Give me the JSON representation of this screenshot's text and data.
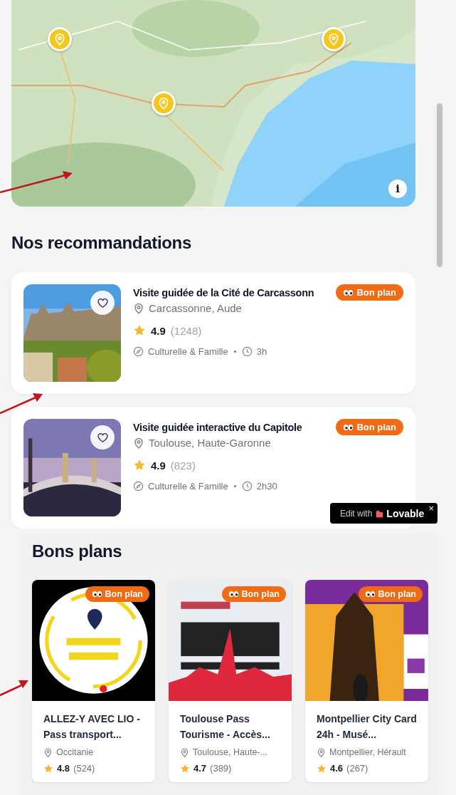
{
  "map": {
    "markers": [
      {
        "kind": "pin"
      },
      {
        "kind": "pin"
      },
      {
        "kind": "pin"
      }
    ],
    "info_button": {
      "label": "i"
    }
  },
  "recommendations": {
    "title": "Nos recommandations",
    "items": [
      {
        "title": "Visite guidée de la Cité de Carcassonn",
        "badge": "Bon plan",
        "location": "Carcassonne, Aude",
        "rating": "4.9",
        "reviews": "(1248)",
        "category": "Culturelle & Famille",
        "duration": "3h"
      },
      {
        "title": "Visite guidée interactive du Capitole",
        "badge": "Bon plan",
        "location": "Toulouse, Haute-Garonne",
        "rating": "4.9",
        "reviews": "(823)",
        "category": "Culturelle & Famille",
        "duration": "2h30"
      }
    ]
  },
  "lovable_badge": {
    "prefix": "Edit with",
    "brand": "Lovable",
    "close": "×"
  },
  "deals": {
    "title": "Bons plans",
    "items": [
      {
        "title": "ALLEZ-Y AVEC LIO - Pass transport...",
        "badge": "Bon plan",
        "location": "Occitanie",
        "rating": "4.8",
        "reviews": "(524)"
      },
      {
        "title": "Toulouse Pass Tourisme - Accès...",
        "badge": "Bon plan",
        "location": "Toulouse, Haute-...",
        "rating": "4.7",
        "reviews": "(389)"
      },
      {
        "title": "Montpellier City Card 24h - Musé...",
        "badge": "Bon plan",
        "location": "Montpellier, Hérault",
        "rating": "4.6",
        "reviews": "(267)"
      }
    ]
  }
}
